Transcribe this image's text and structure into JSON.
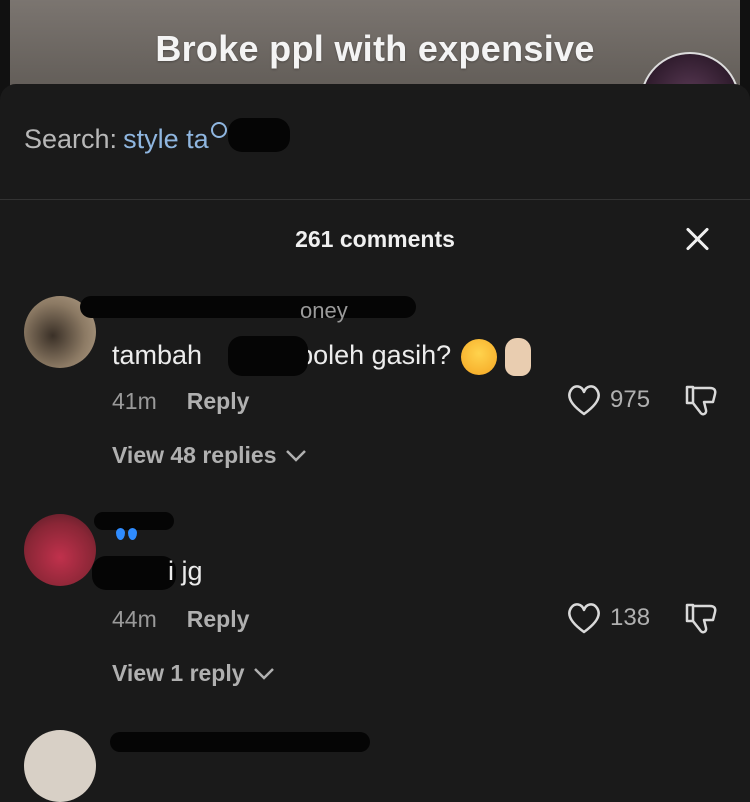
{
  "video": {
    "caption": "Broke ppl with expensive"
  },
  "search": {
    "prefix": "Search:",
    "term": "style ta"
  },
  "header": {
    "title": "261 comments"
  },
  "comments": [
    {
      "username": "oney",
      "text_a": "tambah",
      "text_b": "boleh gasih?",
      "time": "41m",
      "reply_label": "Reply",
      "likes": "975",
      "view_replies": "View 48 replies"
    },
    {
      "username": "",
      "text_a": "i jg",
      "time": "44m",
      "reply_label": "Reply",
      "likes": "138",
      "view_replies": "View 1 reply"
    }
  ],
  "icons": {
    "close": "close-icon",
    "heart": "heart-icon",
    "dislike": "dislike-icon",
    "chevron": "chevron-down-icon",
    "search": "search-icon"
  },
  "colors": {
    "background": "#1a1a1a",
    "search_term": "#8fb6e0",
    "muted_text": "#9a9a9a"
  }
}
